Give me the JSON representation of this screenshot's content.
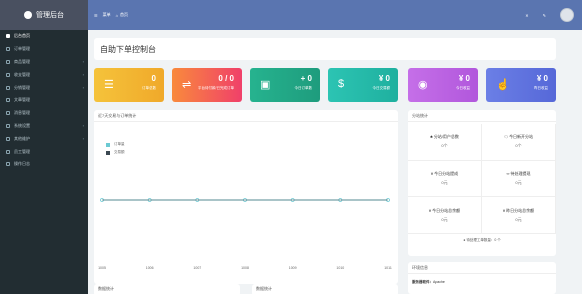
{
  "app": {
    "title": "管理后台"
  },
  "sidebar": {
    "items": [
      {
        "label": "后台首页",
        "active": true,
        "chevron": false
      },
      {
        "label": "订单管理",
        "active": false,
        "chevron": false
      },
      {
        "label": "商品管理",
        "active": false,
        "chevron": true
      },
      {
        "label": "收支管理",
        "active": false,
        "chevron": true
      },
      {
        "label": "分销管理",
        "active": false,
        "chevron": true
      },
      {
        "label": "文章管理",
        "active": false,
        "chevron": false
      },
      {
        "label": "消息管理",
        "active": false,
        "chevron": false
      },
      {
        "label": "系统设置",
        "active": false,
        "chevron": true
      },
      {
        "label": "其他维护",
        "active": false,
        "chevron": true
      },
      {
        "label": "员工管理",
        "active": false,
        "chevron": false
      },
      {
        "label": "操作日志",
        "active": false,
        "chevron": false
      }
    ]
  },
  "topbar": {
    "menu_label": "菜单",
    "home_label": "首页"
  },
  "page_title": "自助下单控制台",
  "stats": [
    {
      "value": "0",
      "label": "订单总数",
      "icon": "list-icon",
      "color_from": "#f5c33b",
      "color_to": "#f0a92a"
    },
    {
      "value": "0 / 0",
      "label": "平台待付款/已完成订单",
      "icon": "sliders-icon",
      "color_from": "#f98a3c",
      "color_to": "#f0406a"
    },
    {
      "value": "+ 0",
      "label": "今日订单数",
      "icon": "calendar-icon",
      "color_from": "#26b38f",
      "color_to": "#1e9c7d"
    },
    {
      "value": "¥ 0",
      "label": "今日交易额",
      "icon": "dollar-icon",
      "color_from": "#2cc4b3",
      "color_to": "#1fb09f"
    },
    {
      "value": "¥ 0",
      "label": "今日收益",
      "icon": "eye-icon",
      "color_from": "#c56fe8",
      "color_to": "#b157dc"
    },
    {
      "value": "¥ 0",
      "label": "昨日收益",
      "icon": "hand-icon",
      "color_from": "#6b7fe6",
      "color_to": "#5668d8"
    }
  ],
  "chart_card": {
    "title": "近7天交易与订单统计"
  },
  "chart_data": {
    "type": "line",
    "x": [
      "1005",
      "1006",
      "1007",
      "1008",
      "1009",
      "1010",
      "1011"
    ],
    "series": [
      {
        "name": "订单量",
        "values": [
          0,
          0,
          0,
          0,
          0,
          0,
          0
        ],
        "color": "#6ccad3"
      },
      {
        "name": "交易额",
        "values": [
          0,
          0,
          0,
          0,
          0,
          0,
          0
        ],
        "color": "#3b4852"
      }
    ],
    "grid": false,
    "legend": "top-left"
  },
  "dist_card": {
    "title": "分站统计",
    "cells": [
      {
        "label": "分站/用户总数",
        "value": "0个",
        "icon": "sitemap-icon"
      },
      {
        "label": "今日新开分站",
        "value": "0个",
        "icon": "cloud-icon"
      },
      {
        "label": "今日分站提成",
        "value": "0元",
        "icon": "yen-icon"
      },
      {
        "label": "待处理提现",
        "value": "0元",
        "icon": "link-icon"
      },
      {
        "label": "今日分站总余额",
        "value": "0元",
        "icon": "yen-icon"
      },
      {
        "label": "昨日分站总余额",
        "value": "0元",
        "icon": "yen-icon"
      }
    ],
    "footer": "待处理工单数量：0 个"
  },
  "env_card": {
    "title": "环境信息",
    "row_label": "服务器软件：",
    "row_value": "Apache"
  },
  "mini_cards": [
    "数据统计",
    "数据统计"
  ],
  "colors": {
    "topbar": "#5a75b0",
    "sidebar": "#222d32",
    "logo": "#495060"
  }
}
